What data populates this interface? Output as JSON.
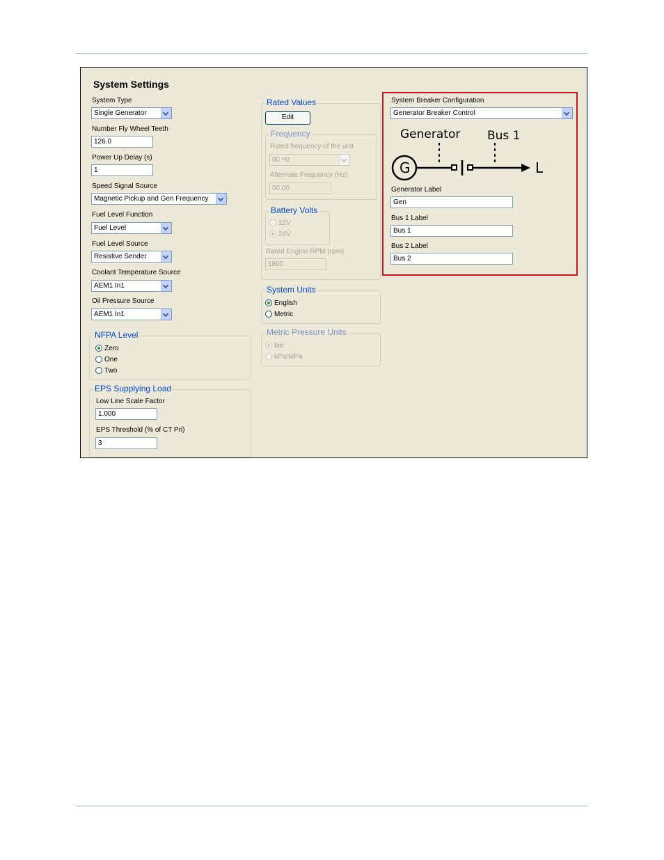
{
  "window": {
    "title": "System Settings"
  },
  "left": {
    "system_type": {
      "label": "System Type",
      "value": "Single Generator"
    },
    "fly_wheel_teeth": {
      "label": "Number Fly Wheel Teeth",
      "value": "126.0"
    },
    "power_up_delay": {
      "label": "Power Up Delay (s)",
      "value": "1"
    },
    "speed_signal_source": {
      "label": "Speed Signal Source",
      "value": "Magnetic Pickup and Gen Frequency"
    },
    "fuel_level_function": {
      "label": "Fuel Level Function",
      "value": "Fuel Level"
    },
    "fuel_level_source": {
      "label": "Fuel Level Source",
      "value": "Resistive Sender"
    },
    "coolant_temp_source": {
      "label": "Coolant Temperature Source",
      "value": "AEM1 In1"
    },
    "oil_pressure_source": {
      "label": "Oil Pressure Source",
      "value": "AEM1 In1"
    },
    "nfpa_level": {
      "title": "NFPA Level",
      "options": [
        "Zero",
        "One",
        "Two"
      ],
      "selected": "Zero"
    },
    "eps": {
      "title": "EPS Supplying Load",
      "low_line_label": "Low Line Scale Factor",
      "low_line_value": "1.000",
      "threshold_label": "EPS Threshold (% of CT Pri)",
      "threshold_value": "3"
    }
  },
  "middle": {
    "rated_values": {
      "title": "Rated Values",
      "edit_label": "Edit",
      "frequency": {
        "title": "Frequency",
        "rated_label": "Rated frequency of the unit",
        "rated_value": "60 Hz",
        "alt_label": "Alternate Frequency (Hz)",
        "alt_value": "50.00"
      },
      "battery": {
        "title": "Battery Volts",
        "options": [
          "12V",
          "24V"
        ],
        "selected": "24V"
      },
      "rpm_label": "Rated Engine RPM (rpm)",
      "rpm_value": "1800"
    },
    "system_units": {
      "title": "System Units",
      "options": [
        "English",
        "Metric"
      ],
      "selected": "English"
    },
    "metric_pressure": {
      "title": "Metric Pressure Units",
      "options": [
        "bar",
        "kPa/MPa"
      ],
      "selected": "bar"
    }
  },
  "right": {
    "breaker_config": {
      "label": "System Breaker Configuration",
      "value": "Generator Breaker Control"
    },
    "diagram": {
      "generator": "Generator",
      "bus1": "Bus 1",
      "g": "G",
      "l": "L"
    },
    "generator_label": {
      "label": "Generator Label",
      "value": "Gen"
    },
    "bus1_label": {
      "label": "Bus 1 Label",
      "value": "Bus 1"
    },
    "bus2_label": {
      "label": "Bus 2 Label",
      "value": "Bus 2"
    }
  },
  "colors": {
    "group_title": "#0046d5",
    "highlight": "#c8171f",
    "panel_bg": "#ece9d8"
  }
}
